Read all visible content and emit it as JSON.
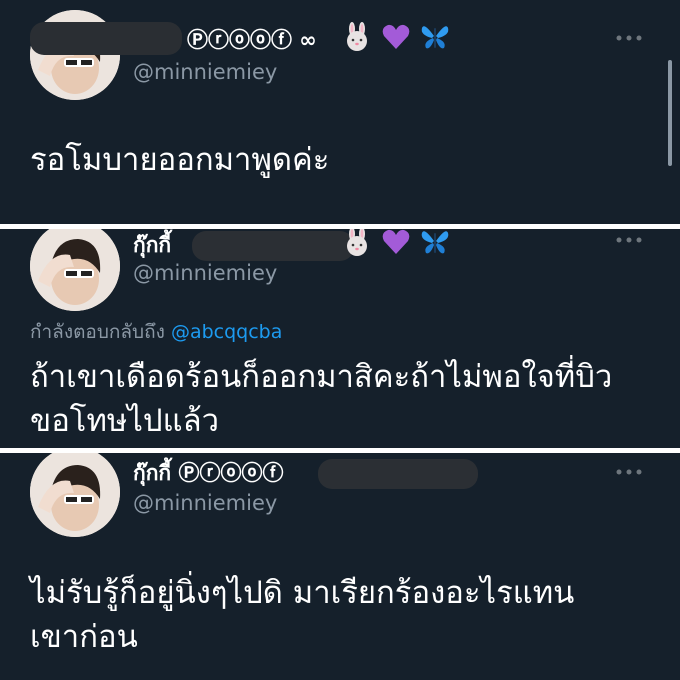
{
  "tweets": [
    {
      "display_name": "Ⓟⓡⓞⓞⓕ ∞",
      "handle": "@minniemiey",
      "text": "รอโมบายออกมาพูดค่ะ",
      "emojis": [
        "rabbit-icon",
        "purple-heart-icon",
        "butterfly-icon"
      ]
    },
    {
      "display_name": "กุ๊กกี้",
      "handle": "@minniemiey",
      "reply_prefix": "กำลังตอบกลับถึง",
      "reply_to": "@abcqqcba",
      "text": "ถ้าเขาเดือดร้อนก็ออกมาสิคะถ้าไม่พอใจที่บิวขอโทษไปแล้ว",
      "emojis": [
        "rabbit-icon",
        "purple-heart-icon",
        "butterfly-icon"
      ]
    },
    {
      "display_name": "กุ๊กกี้ Ⓟⓡⓞⓞⓕ",
      "handle": "@minniemiey",
      "text": "ไม่รับรู้ก็อยู่นิ่งๆไปดิ มาเรียกร้องอะไรแทนเขาก่อน"
    }
  ],
  "colors": {
    "background": "#15202b",
    "secondary_text": "#8b98a5",
    "mention": "#1d9bf0",
    "separator": "#ffffff"
  }
}
